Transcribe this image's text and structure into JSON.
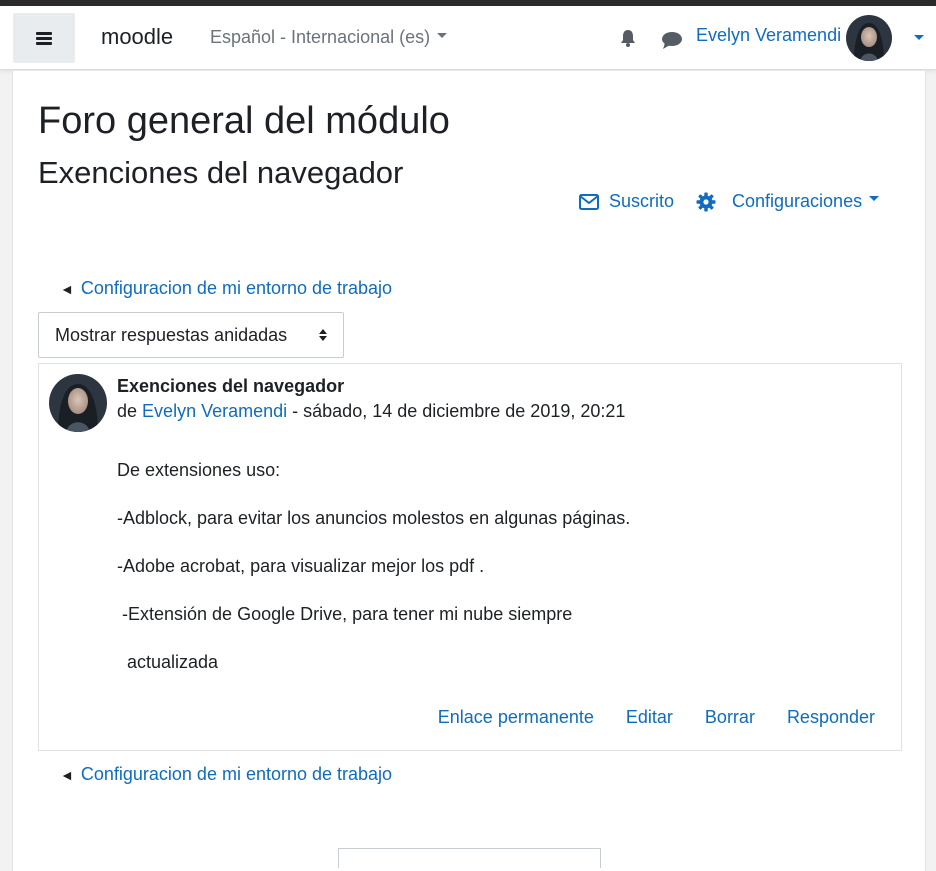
{
  "navbar": {
    "brand": "moodle",
    "language": "Español - Internacional (es)",
    "user_name": "Evelyn Veramendi",
    "icons": [
      "menu-icon",
      "bell-icon",
      "chat-icon",
      "avatar",
      "chevron-down-icon"
    ]
  },
  "header": {
    "course_title": "Foro general del módulo",
    "discussion_title": "Exenciones del navegador",
    "subscribed_label": "Suscrito",
    "settings_label": "Configuraciones"
  },
  "navigation": {
    "prev_link": "Configuracion de mi entorno de trabajo",
    "bottom_link": "Configuracion de mi entorno de trabajo"
  },
  "display_mode": {
    "selected": "Mostrar respuestas anidadas"
  },
  "post": {
    "subject": "Exenciones del navegador",
    "by_prefix": "de",
    "author": "Evelyn Veramendi",
    "date": "- sábado, 14 de diciembre de 2019, 20:21",
    "body": [
      "De extensiones uso:",
      "-Adblock, para evitar los anuncios molestos en algunas páginas.",
      "-Adobe acrobat, para visualizar mejor los pdf .",
      " -Extensión de Google Drive, para tener mi nube siempre",
      "  actualizada"
    ],
    "actions": {
      "permalink": "Enlace permanente",
      "edit": "Editar",
      "delete": "Borrar",
      "reply": "Responder"
    }
  },
  "colors": {
    "link": "#0f6cbf",
    "text": "#1d2125",
    "muted": "#6a737b"
  }
}
